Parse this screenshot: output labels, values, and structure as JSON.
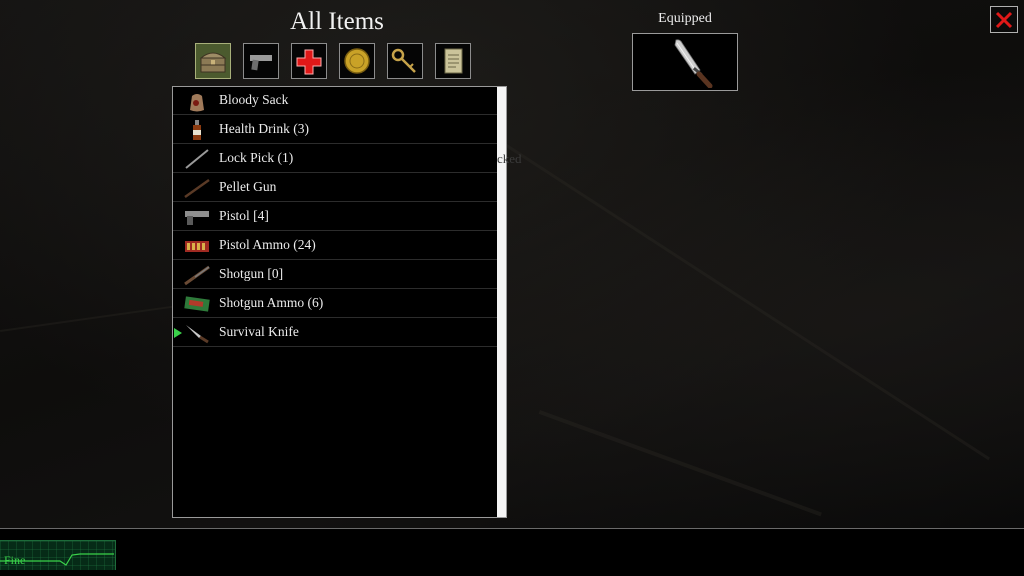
{
  "inventory": {
    "title": "All Items",
    "category_tabs": [
      {
        "name": "all-items",
        "icon": "chest-icon",
        "active": true
      },
      {
        "name": "weapons",
        "icon": "pistol-icon",
        "active": false
      },
      {
        "name": "health",
        "icon": "red-cross-icon",
        "active": false
      },
      {
        "name": "coins",
        "icon": "coin-icon",
        "active": false
      },
      {
        "name": "keys",
        "icon": "key-icon",
        "active": false
      },
      {
        "name": "documents",
        "icon": "document-icon",
        "active": false
      }
    ],
    "items": [
      {
        "label": "Bloody Sack",
        "icon": "sack-icon",
        "selected": false
      },
      {
        "label": "Health Drink (3)",
        "icon": "bottle-icon",
        "selected": false
      },
      {
        "label": "Lock Pick (1)",
        "icon": "lockpick-icon",
        "selected": false
      },
      {
        "label": "Pellet Gun",
        "icon": "rifle-icon",
        "selected": false
      },
      {
        "label": "Pistol [4]",
        "icon": "pistol-icon",
        "selected": false
      },
      {
        "label": "Pistol Ammo (24)",
        "icon": "ammo-box-icon",
        "selected": false
      },
      {
        "label": "Shotgun [0]",
        "icon": "shotgun-icon",
        "selected": false
      },
      {
        "label": "Shotgun Ammo (6)",
        "icon": "shells-box-icon",
        "selected": false
      },
      {
        "label": "Survival Knife",
        "icon": "knife-icon",
        "selected": true
      }
    ]
  },
  "background_text": "cked",
  "equipped": {
    "label": "Equipped",
    "item_icon": "knife-icon"
  },
  "status": {
    "health_text": "Fine",
    "color": "#3ad14a"
  },
  "colors": {
    "active_tab": "#4b5a2e",
    "selection_marker": "#3ad14a",
    "close_icon": "#e01818"
  }
}
